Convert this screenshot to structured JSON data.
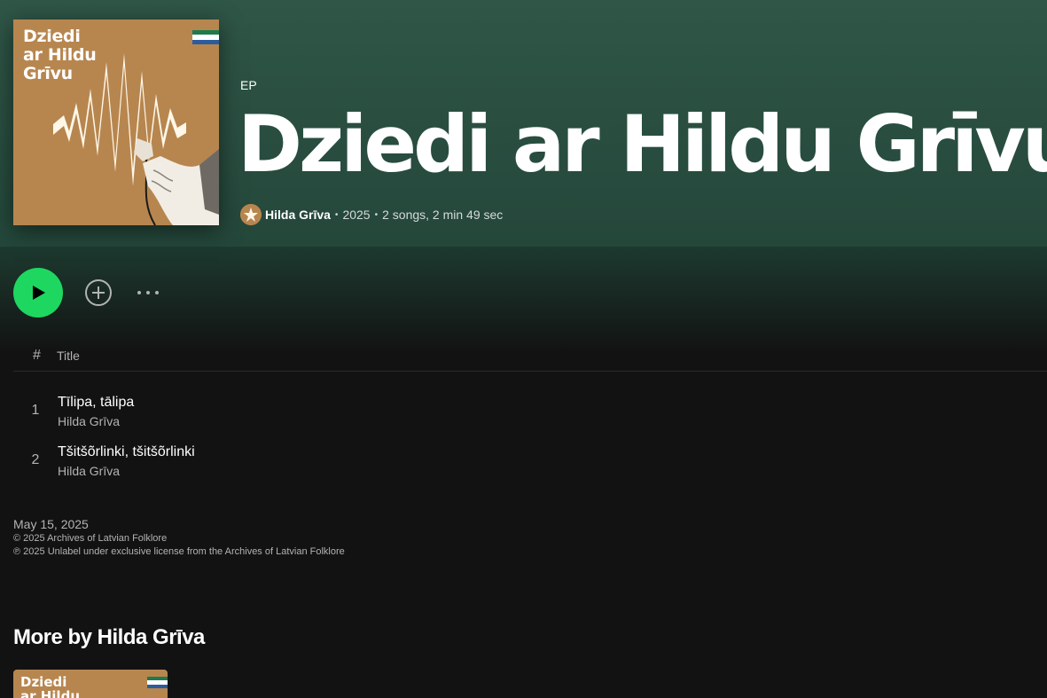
{
  "album": {
    "kind": "EP",
    "title": "Dziedi ar Hildu Grīvu",
    "cover_lines": [
      "Dziedi",
      "ar Hildu",
      "Grīvu"
    ],
    "artist": "Hilda Grīva",
    "year": "2025",
    "summary": "2 songs, 2 min 49 sec"
  },
  "colors": {
    "header_bg": "#2f5647",
    "accent_play": "#1ed760",
    "cover_bg": "#b7864f",
    "flag_stripes": [
      "#1f7a4d",
      "#ffffff",
      "#2b5c9e"
    ]
  },
  "actions": {
    "play_icon": "play-icon",
    "add_icon": "add-circle-icon",
    "more_icon": "more-options-icon"
  },
  "tracklist": {
    "headers": {
      "number": "#",
      "title": "Title"
    },
    "tracks": [
      {
        "number": "1",
        "title": "Tīlipa, tālipa",
        "artist": "Hilda Grīva"
      },
      {
        "number": "2",
        "title": "Tšitšõrlinki, tšitšõrlinki",
        "artist": "Hilda Grīva"
      }
    ]
  },
  "release": {
    "date": "May 15, 2025",
    "copyright": "© 2025 Archives of Latvian Folklore",
    "phonogram": "℗ 2025 Unlabel under exclusive license from the Archives of Latvian Folklore"
  },
  "more_by": {
    "heading": "More by Hilda Grīva",
    "card_lines": [
      "Dziedi",
      "ar Hildu"
    ]
  }
}
